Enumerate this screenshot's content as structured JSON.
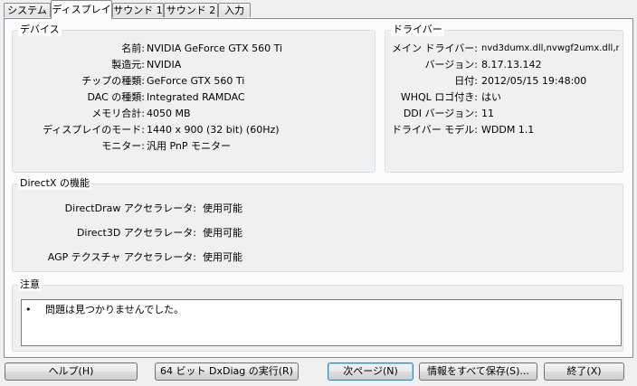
{
  "tabs": [
    {
      "label": "システム"
    },
    {
      "label": "ディスプレイ"
    },
    {
      "label": "サウンド 1"
    },
    {
      "label": "サウンド 2"
    },
    {
      "label": "入力"
    }
  ],
  "device": {
    "title": "デバイス",
    "rows": [
      {
        "label": "名前:",
        "value": "NVIDIA GeForce GTX 560 Ti"
      },
      {
        "label": "製造元:",
        "value": "NVIDIA"
      },
      {
        "label": "チップの種類:",
        "value": "GeForce GTX 560 Ti"
      },
      {
        "label": "DAC の種類:",
        "value": "Integrated RAMDAC"
      },
      {
        "label": "メモリ合計:",
        "value": "4050 MB"
      },
      {
        "label": "ディスプレイのモード:",
        "value": "1440 x 900 (32 bit) (60Hz)"
      },
      {
        "label": "モニター:",
        "value": "汎用 PnP モニター"
      }
    ]
  },
  "driver": {
    "title": "ドライバー",
    "rows": [
      {
        "label": "メイン ドライバー:",
        "value": "nvd3dumx.dll,nvwgf2umx.dll,n"
      },
      {
        "label": "バージョン:",
        "value": "8.17.13.142"
      },
      {
        "label": "日付:",
        "value": "2012/05/15 19:48:00"
      },
      {
        "label": "WHQL ロゴ付き:",
        "value": "はい"
      },
      {
        "label": "DDI バージョン:",
        "value": "11"
      },
      {
        "label": "ドライバー モデル:",
        "value": "WDDM 1.1"
      }
    ]
  },
  "directx": {
    "title": "DirectX の機能",
    "rows": [
      {
        "label": "DirectDraw アクセラレータ:",
        "value": "使用可能"
      },
      {
        "label": "Direct3D アクセラレータ:",
        "value": "使用可能"
      },
      {
        "label": "AGP テクスチャ アクセラレータ:",
        "value": "使用可能"
      }
    ]
  },
  "notes": {
    "title": "注意",
    "bullet": "•",
    "text": "問題は見つかりませんでした。"
  },
  "buttons": {
    "help": "ヘルプ(H)",
    "run64": "64 ビット DxDiag の実行(R)",
    "next": "次ページ(N)",
    "save_all": "情報をすべて保存(S)...",
    "exit": "終了(X)"
  }
}
